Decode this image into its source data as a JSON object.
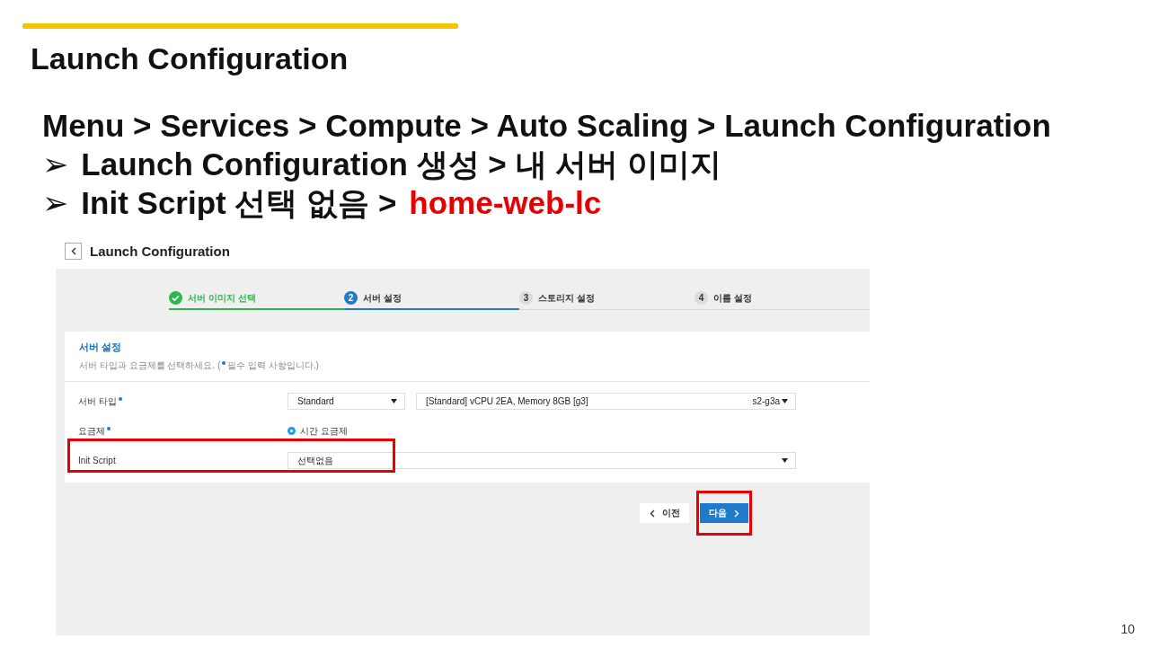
{
  "slide": {
    "title": "Launch Configuration",
    "page_number": "10",
    "lines": [
      {
        "parts": [
          {
            "text": "Menu > Services > Compute > Auto Scaling > Launch Configuration",
            "emphasis": false
          }
        ]
      },
      {
        "bullet": "➢",
        "parts": [
          {
            "text": "Launch Configuration 생성 > 내 서버 이미지",
            "emphasis": false
          }
        ]
      },
      {
        "bullet": "➢",
        "parts": [
          {
            "text": "Init Script 선택 없음  >",
            "emphasis": false
          },
          {
            "text": "home-web-lc",
            "emphasis": true
          }
        ]
      }
    ]
  },
  "screen": {
    "title": "Launch Configuration",
    "steps": [
      {
        "label": "서버 이미지 선택",
        "completed": true,
        "selected": false
      },
      {
        "number": "2",
        "label": "서버 설정",
        "completed": false,
        "selected": true
      },
      {
        "number": "3",
        "label": "스토리지 설정",
        "completed": false,
        "selected": false
      },
      {
        "number": "4",
        "label": "이름 설정",
        "completed": false,
        "selected": false
      }
    ],
    "section": {
      "title": "서버 설정",
      "description_before": "서버 타입과 요금제를 선택하세요. (",
      "description_after": "필수 입력 사항입니다.)"
    },
    "fields": [
      {
        "kind": "selects",
        "label": "서버 타입",
        "required": true,
        "highlighted": false,
        "selects": [
          {
            "value": "Standard"
          },
          {
            "value": "[Standard] vCPU 2EA, Memory 8GB [g3]",
            "suffix": "s2-g3a"
          }
        ]
      },
      {
        "kind": "radio",
        "label": "요금제",
        "required": true,
        "highlighted": false,
        "option": {
          "label": "시간 요금제",
          "selected": true
        }
      },
      {
        "kind": "select",
        "label": "Init Script",
        "required": false,
        "highlighted": true,
        "value": "선택없음"
      }
    ],
    "buttons": [
      {
        "label": "이전",
        "kind": "prev",
        "highlighted": false
      },
      {
        "label": "다음",
        "kind": "next",
        "highlighted": true
      }
    ]
  }
}
